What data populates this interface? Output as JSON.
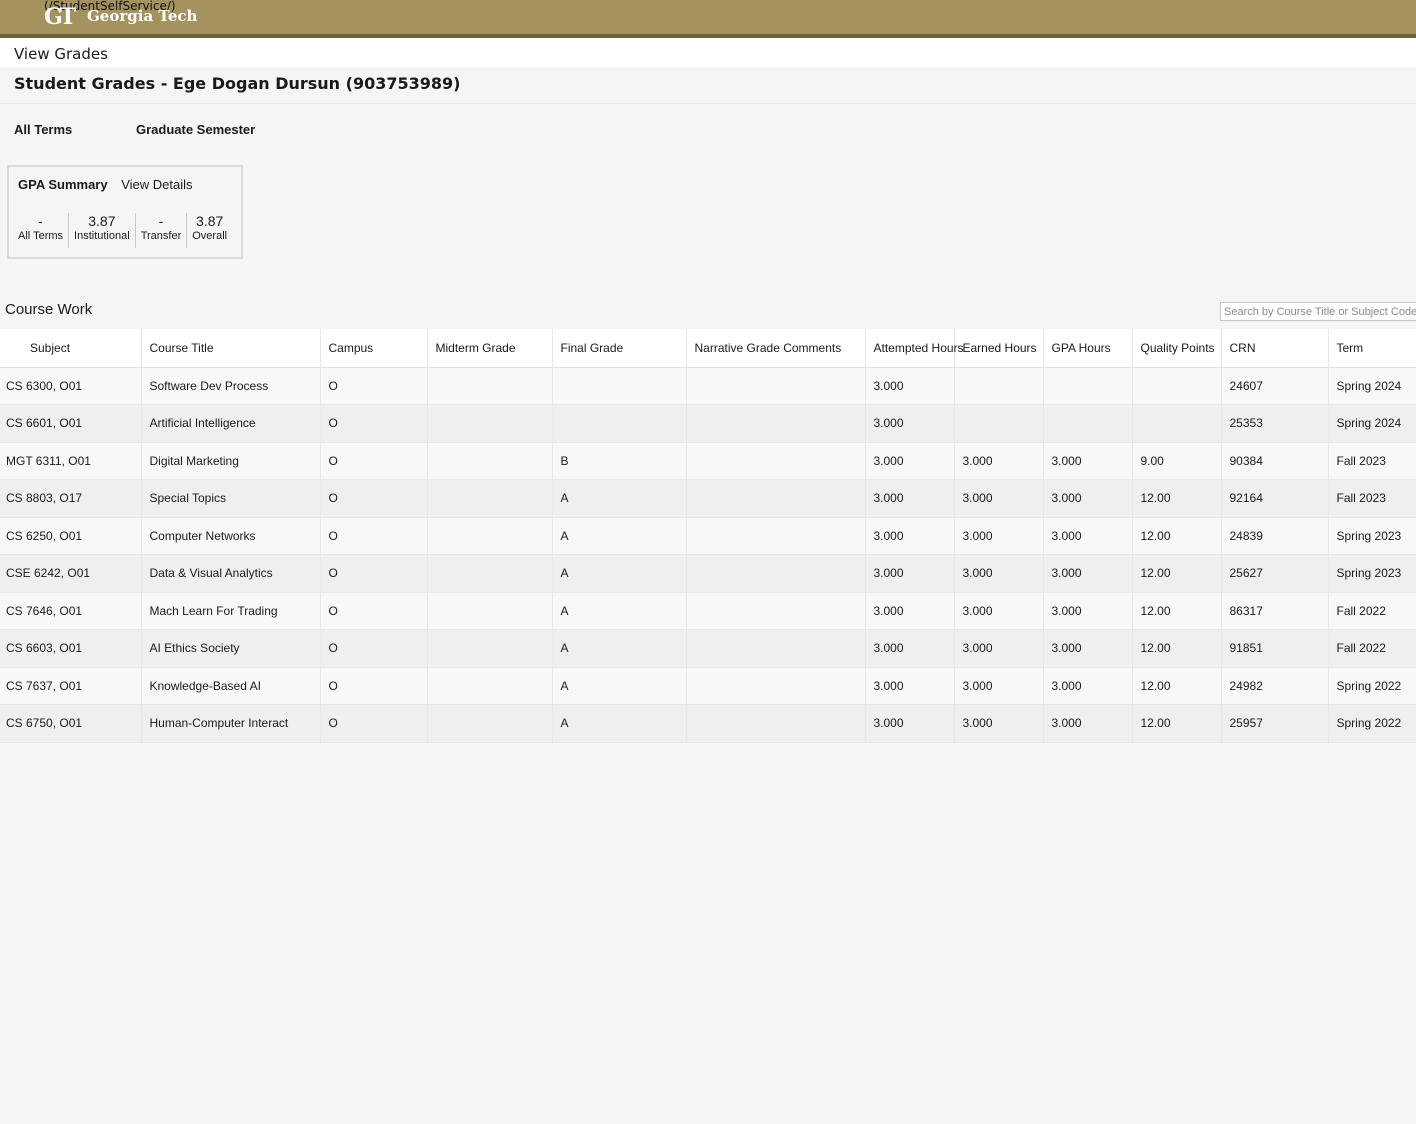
{
  "header": {
    "logo_mark": "GT",
    "logo_text": "Georgia Tech",
    "logo_link_text": "(/StudentSelfService/)",
    "logo_icon": "gt-logo-icon"
  },
  "page": {
    "view_title": "View Grades",
    "student_title": "Student Grades - Ege Dogan Dursun (903753989)"
  },
  "filters": {
    "term_label": "All Terms",
    "level_label": "Graduate Semester"
  },
  "gpa_summary": {
    "title": "GPA Summary",
    "details_link": "View Details",
    "cells": [
      {
        "value": "-",
        "label": "All Terms"
      },
      {
        "value": "3.87",
        "label": "Institutional"
      },
      {
        "value": "-",
        "label": "Transfer"
      },
      {
        "value": "3.87",
        "label": "Overall"
      }
    ]
  },
  "course_work": {
    "title": "Course Work",
    "search_placeholder": "Search by Course Title or Subject Code (",
    "columns": [
      "Subject",
      "Course Title",
      "Campus",
      "Midterm Grade",
      "Final Grade",
      "Narrative Grade Comments",
      "Attempted Hours",
      "Earned Hours",
      "GPA Hours",
      "Quality Points",
      "CRN",
      "Term"
    ],
    "rows": [
      [
        "CS 6300, O01",
        "Software Dev Process",
        "O",
        "",
        "",
        "",
        "3.000",
        "",
        "",
        "",
        "24607",
        "Spring 2024"
      ],
      [
        "CS 6601, O01",
        "Artificial Intelligence",
        "O",
        "",
        "",
        "",
        "3.000",
        "",
        "",
        "",
        "25353",
        "Spring 2024"
      ],
      [
        "MGT 6311, O01",
        "Digital Marketing",
        "O",
        "",
        "B",
        "",
        "3.000",
        "3.000",
        "3.000",
        "9.00",
        "90384",
        "Fall 2023"
      ],
      [
        "CS 8803, O17",
        "Special Topics",
        "O",
        "",
        "A",
        "",
        "3.000",
        "3.000",
        "3.000",
        "12.00",
        "92164",
        "Fall 2023"
      ],
      [
        "CS 6250, O01",
        "Computer Networks",
        "O",
        "",
        "A",
        "",
        "3.000",
        "3.000",
        "3.000",
        "12.00",
        "24839",
        "Spring 2023"
      ],
      [
        "CSE 6242, O01",
        "Data & Visual Analytics",
        "O",
        "",
        "A",
        "",
        "3.000",
        "3.000",
        "3.000",
        "12.00",
        "25627",
        "Spring 2023"
      ],
      [
        "CS 7646, O01",
        "Mach Learn For Trading",
        "O",
        "",
        "A",
        "",
        "3.000",
        "3.000",
        "3.000",
        "12.00",
        "86317",
        "Fall 2022"
      ],
      [
        "CS 6603, O01",
        "AI Ethics Society",
        "O",
        "",
        "A",
        "",
        "3.000",
        "3.000",
        "3.000",
        "12.00",
        "91851",
        "Fall 2022"
      ],
      [
        "CS 7637, O01",
        "Knowledge-Based AI",
        "O",
        "",
        "A",
        "",
        "3.000",
        "3.000",
        "3.000",
        "12.00",
        "24982",
        "Spring 2022"
      ],
      [
        "CS 6750, O01",
        "Human-Computer Interact",
        "O",
        "",
        "A",
        "",
        "3.000",
        "3.000",
        "3.000",
        "12.00",
        "25957",
        "Spring 2022"
      ]
    ]
  },
  "colors": {
    "header_gold": "#a4925f",
    "header_border": "#6f6232",
    "page_background": "#f4f6f5"
  }
}
